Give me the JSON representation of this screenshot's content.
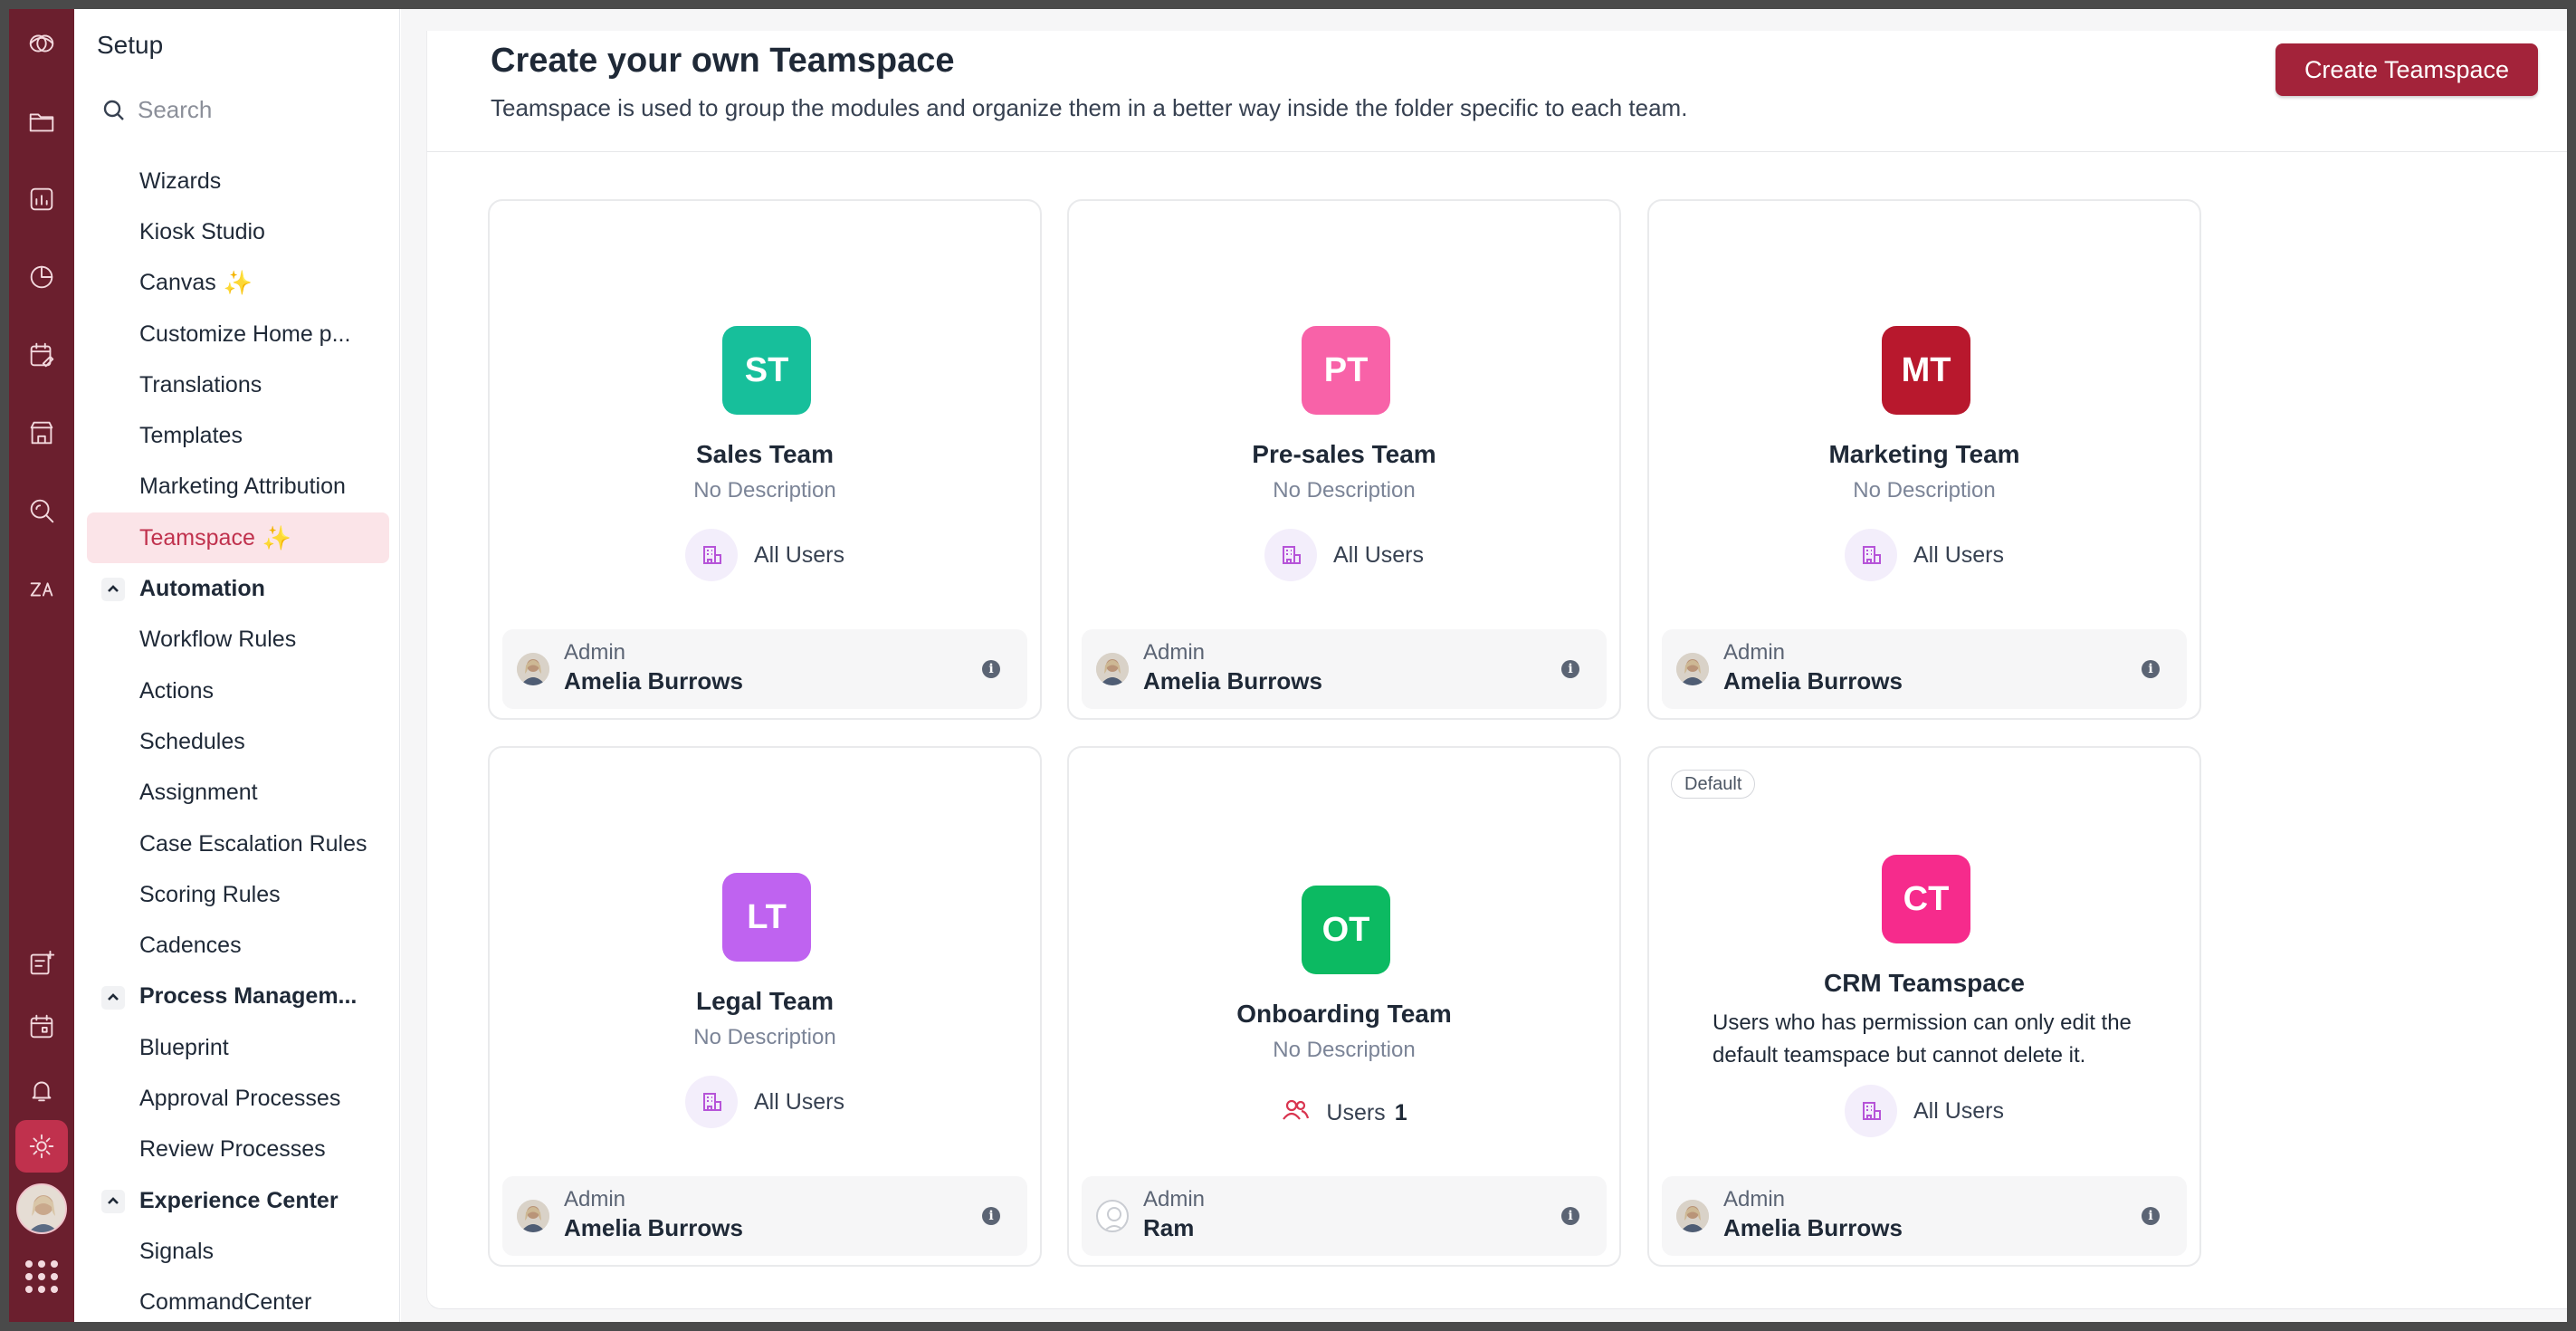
{
  "sidebar": {
    "title": "Setup",
    "search_placeholder": "Search",
    "items": [
      {
        "type": "item",
        "label": "Wizards"
      },
      {
        "type": "item",
        "label": "Kiosk Studio"
      },
      {
        "type": "item",
        "label": "Canvas",
        "sparkle": true
      },
      {
        "type": "item",
        "label": "Customize Home p..."
      },
      {
        "type": "item",
        "label": "Translations"
      },
      {
        "type": "item",
        "label": "Templates"
      },
      {
        "type": "item",
        "label": "Marketing Attribution"
      },
      {
        "type": "item",
        "label": "Teamspace",
        "sparkle": true,
        "active": true
      },
      {
        "type": "section",
        "label": "Automation"
      },
      {
        "type": "item",
        "label": "Workflow Rules"
      },
      {
        "type": "item",
        "label": "Actions"
      },
      {
        "type": "item",
        "label": "Schedules"
      },
      {
        "type": "item",
        "label": "Assignment"
      },
      {
        "type": "item",
        "label": "Case Escalation Rules"
      },
      {
        "type": "item",
        "label": "Scoring Rules"
      },
      {
        "type": "item",
        "label": "Cadences"
      },
      {
        "type": "section",
        "label": "Process Managem..."
      },
      {
        "type": "item",
        "label": "Blueprint"
      },
      {
        "type": "item",
        "label": "Approval Processes"
      },
      {
        "type": "item",
        "label": "Review Processes"
      },
      {
        "type": "section",
        "label": "Experience Center"
      },
      {
        "type": "item",
        "label": "Signals"
      },
      {
        "type": "item",
        "label": "CommandCenter"
      }
    ]
  },
  "rail": {
    "icons": [
      "cloud-logo-icon",
      "folder-icon",
      "reports-icon",
      "analytics-icon",
      "calendar-edit-icon",
      "marketplace-icon",
      "search-zoom-icon",
      "zia-icon",
      "notes-add-icon",
      "calendar-icon",
      "bell-icon",
      "gear-icon"
    ]
  },
  "header": {
    "title": "Create your own Teamspace",
    "description": "Teamspace is used to group the modules and organize them in a better way inside the folder specific to each team.",
    "create_button": "Create Teamspace"
  },
  "teams": [
    {
      "initials": "ST",
      "color": "#17bf9b",
      "name": "Sales Team",
      "description": "No Description",
      "access": "All Users",
      "admin_label": "Admin",
      "admin_name": "Amelia Burrows"
    },
    {
      "initials": "PT",
      "color": "#f862a8",
      "name": "Pre-sales Team",
      "description": "No Description",
      "access": "All Users",
      "admin_label": "Admin",
      "admin_name": "Amelia Burrows"
    },
    {
      "initials": "MT",
      "color": "#b8182d",
      "name": "Marketing Team",
      "description": "No Description",
      "access": "All Users",
      "admin_label": "Admin",
      "admin_name": "Amelia Burrows"
    },
    {
      "initials": "LT",
      "color": "#bf63f0",
      "name": "Legal Team",
      "description": "No Description",
      "access": "All Users",
      "admin_label": "Admin",
      "admin_name": "Amelia Burrows"
    },
    {
      "initials": "OT",
      "color": "#0cba62",
      "name": "Onboarding Team",
      "description": "No Description",
      "access": "Users",
      "access_count": "1",
      "admin_label": "Admin",
      "admin_name": "Ram"
    },
    {
      "initials": "CT",
      "color": "#f62b8c",
      "name": "CRM Teamspace",
      "badge": "Default",
      "description": "Users who has permission can only edit the default teamspace but cannot delete it.",
      "access": "All Users",
      "admin_label": "Admin",
      "admin_name": "Amelia Burrows"
    }
  ]
}
